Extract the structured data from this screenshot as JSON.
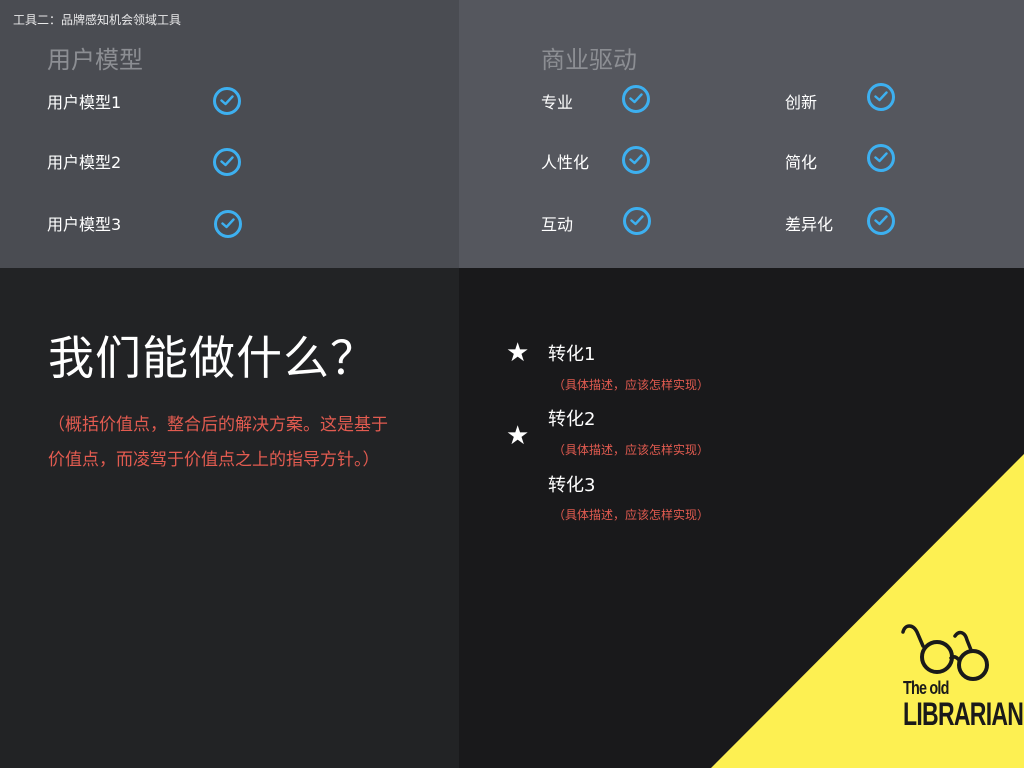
{
  "page_label": "工具二：品牌感知机会领域工具",
  "user_models": {
    "title": "用户模型",
    "items": [
      "用户模型1",
      "用户模型2",
      "用户模型3"
    ]
  },
  "business_drivers": {
    "title": "商业驱动",
    "left_items": [
      "专业",
      "人性化",
      "互动"
    ],
    "right_items": [
      "创新",
      "简化",
      "差异化"
    ]
  },
  "what_we_do": {
    "heading": "我们能做什么？",
    "description": "（概括价值点，整合后的解决方案。这是基于价值点，而凌驾于价值点之上的指导方针。）"
  },
  "conversions": [
    {
      "title": "转化1",
      "desc": "（具体描述，应该怎样实现）"
    },
    {
      "title": "转化2",
      "desc": "（具体描述，应该怎样实现）"
    },
    {
      "title": "转化3",
      "desc": "（具体描述，应该怎样实现）"
    }
  ],
  "logo": {
    "line1": "The old",
    "line2": "LIBRARIAN"
  },
  "icons": {
    "check": "check-circle-icon",
    "star": "star-icon",
    "glasses": "glasses-icon"
  },
  "colors": {
    "check_blue": "#3db0f0",
    "accent_red": "#e25b50",
    "logo_yellow": "#fdf052"
  }
}
